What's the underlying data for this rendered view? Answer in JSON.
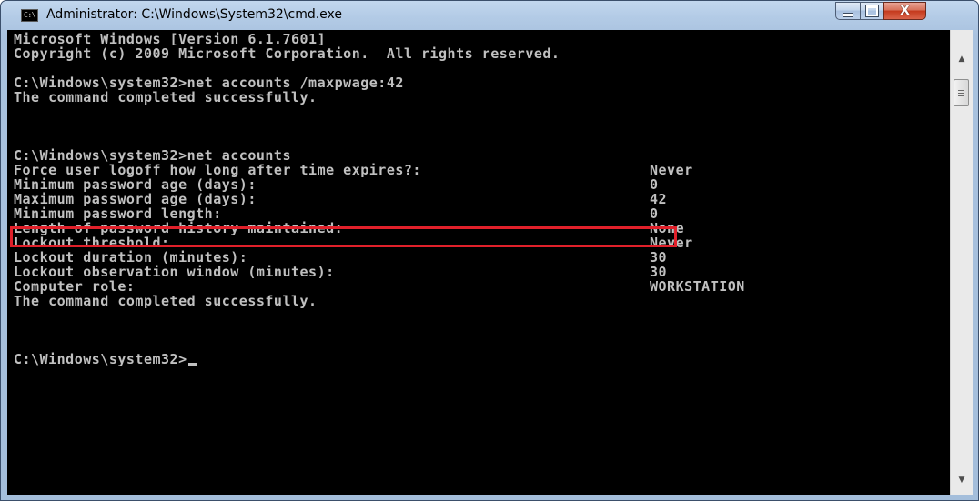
{
  "window": {
    "title": "Administrator: C:\\Windows\\System32\\cmd.exe",
    "icon_label": "C:\\",
    "controls": {
      "minimize": "minimize-icon",
      "maximize": "maximize-icon",
      "close": "close-icon",
      "close_glyph": "X"
    }
  },
  "console": {
    "lines": [
      "Microsoft Windows [Version 6.1.7601]",
      "Copyright (c) 2009 Microsoft Corporation.  All rights reserved.",
      "",
      "C:\\Windows\\system32>net accounts /maxpwage:42",
      "The command completed successfully.",
      "",
      "",
      "C:\\Windows\\system32>net accounts"
    ],
    "settings": [
      {
        "label": "Force user logoff how long after time expires?:",
        "value": "Never"
      },
      {
        "label": "Minimum password age (days):",
        "value": "0"
      },
      {
        "label": "Maximum password age (days):",
        "value": "42"
      },
      {
        "label": "Minimum password length:",
        "value": "0"
      },
      {
        "label": "Length of password history maintained:",
        "value": "None"
      },
      {
        "label": "Lockout threshold:",
        "value": "Never"
      },
      {
        "label": "Lockout duration (minutes):",
        "value": "30"
      },
      {
        "label": "Lockout observation window (minutes):",
        "value": "30"
      },
      {
        "label": "Computer role:",
        "value": "WORKSTATION"
      }
    ],
    "completion": "The command completed successfully.",
    "prompt": "C:\\Windows\\system32>"
  },
  "colors": {
    "console_bg": "#000000",
    "console_text": "#c0c0c0",
    "highlight_box": "#e0202a"
  }
}
